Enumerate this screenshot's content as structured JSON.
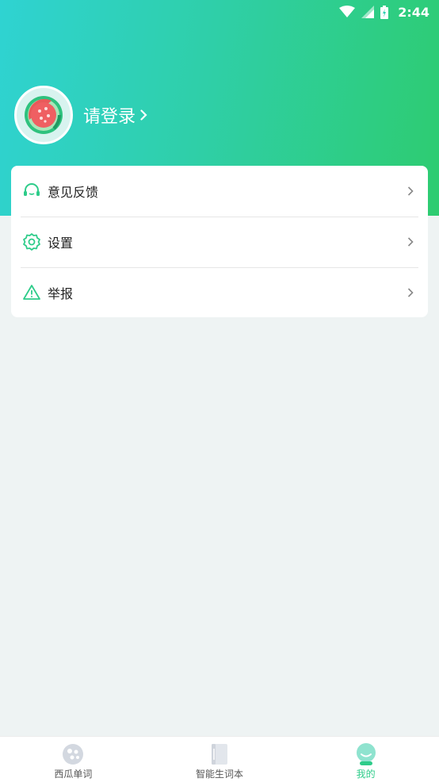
{
  "status_bar": {
    "time": "2:44"
  },
  "profile": {
    "login_label": "请登录"
  },
  "menu": {
    "items": [
      {
        "label": "意见反馈",
        "icon": "headset-icon"
      },
      {
        "label": "设置",
        "icon": "gear-icon"
      },
      {
        "label": "举报",
        "icon": "warning-icon"
      }
    ]
  },
  "tabbar": {
    "tabs": [
      {
        "label": "西瓜单词",
        "icon": "watermelon-ball-icon",
        "active": false
      },
      {
        "label": "智能生词本",
        "icon": "book-icon",
        "active": false
      },
      {
        "label": "我的",
        "icon": "profile-face-icon",
        "active": true
      }
    ]
  },
  "colors": {
    "accent": "#2ecc8a",
    "header_gradient_start": "#2fd3d2",
    "header_gradient_end": "#2ecc70",
    "background": "#eef3f3"
  }
}
